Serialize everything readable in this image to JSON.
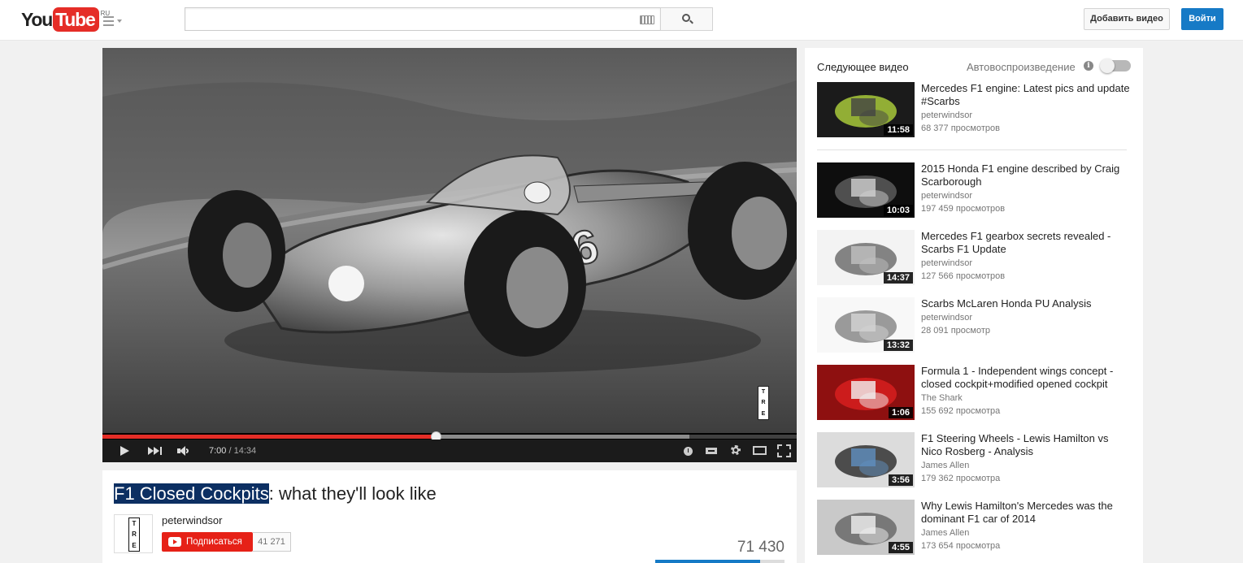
{
  "masthead": {
    "logo_you": "You",
    "logo_tube": "Tube",
    "logo_region": "RU",
    "search_value": "",
    "upload_label": "Добавить видео",
    "signin_label": "Войти"
  },
  "player": {
    "current_time": "7:00",
    "separator": " / ",
    "duration": "14:34",
    "progress_fraction": 0.48,
    "loaded_fraction": 0.846,
    "watermark": [
      "T",
      "R",
      "E"
    ]
  },
  "video": {
    "title_highlight": "F1 Closed Cockpits",
    "title_rest": ": what they'll look like",
    "channel": "peterwindsor",
    "channel_logo": [
      "T",
      "R",
      "E"
    ],
    "subscribe_label": "Подписаться",
    "subscriber_count": "41 271",
    "view_count": "71 430",
    "like_fraction": 0.81
  },
  "sidebar": {
    "up_next_label": "Следующее видео",
    "autoplay_label": "Автовоспроизведение",
    "autoplay_on": false,
    "items": [
      {
        "title": "Mercedes F1 engine: Latest pics and update #Scarbs",
        "channel": "peterwindsor",
        "views": "68 377 просмотров",
        "duration": "11:58"
      },
      {
        "title": "2015 Honda F1 engine described by Craig Scarborough",
        "channel": "peterwindsor",
        "views": "197 459 просмотров",
        "duration": "10:03"
      },
      {
        "title": "Mercedes F1 gearbox secrets revealed - Scarbs F1 Update",
        "channel": "peterwindsor",
        "views": "127 566 просмотров",
        "duration": "14:37"
      },
      {
        "title": "Scarbs McLaren Honda PU Analysis",
        "channel": "peterwindsor",
        "views": "28 091 просмотр",
        "duration": "13:32"
      },
      {
        "title": "Formula 1 - Independent wings concept - closed cockpit+modified opened cockpit",
        "channel": "The Shark",
        "views": "155 692 просмотра",
        "duration": "1:06"
      },
      {
        "title": "F1 Steering Wheels - Lewis Hamilton vs Nico Rosberg - Analysis",
        "channel": "James Allen",
        "views": "179 362 просмотра",
        "duration": "3:56"
      },
      {
        "title": "Why Lewis Hamilton's Mercedes was the dominant F1 car of 2014",
        "channel": "James Allen",
        "views": "173 654 просмотра",
        "duration": "4:55"
      }
    ]
  }
}
